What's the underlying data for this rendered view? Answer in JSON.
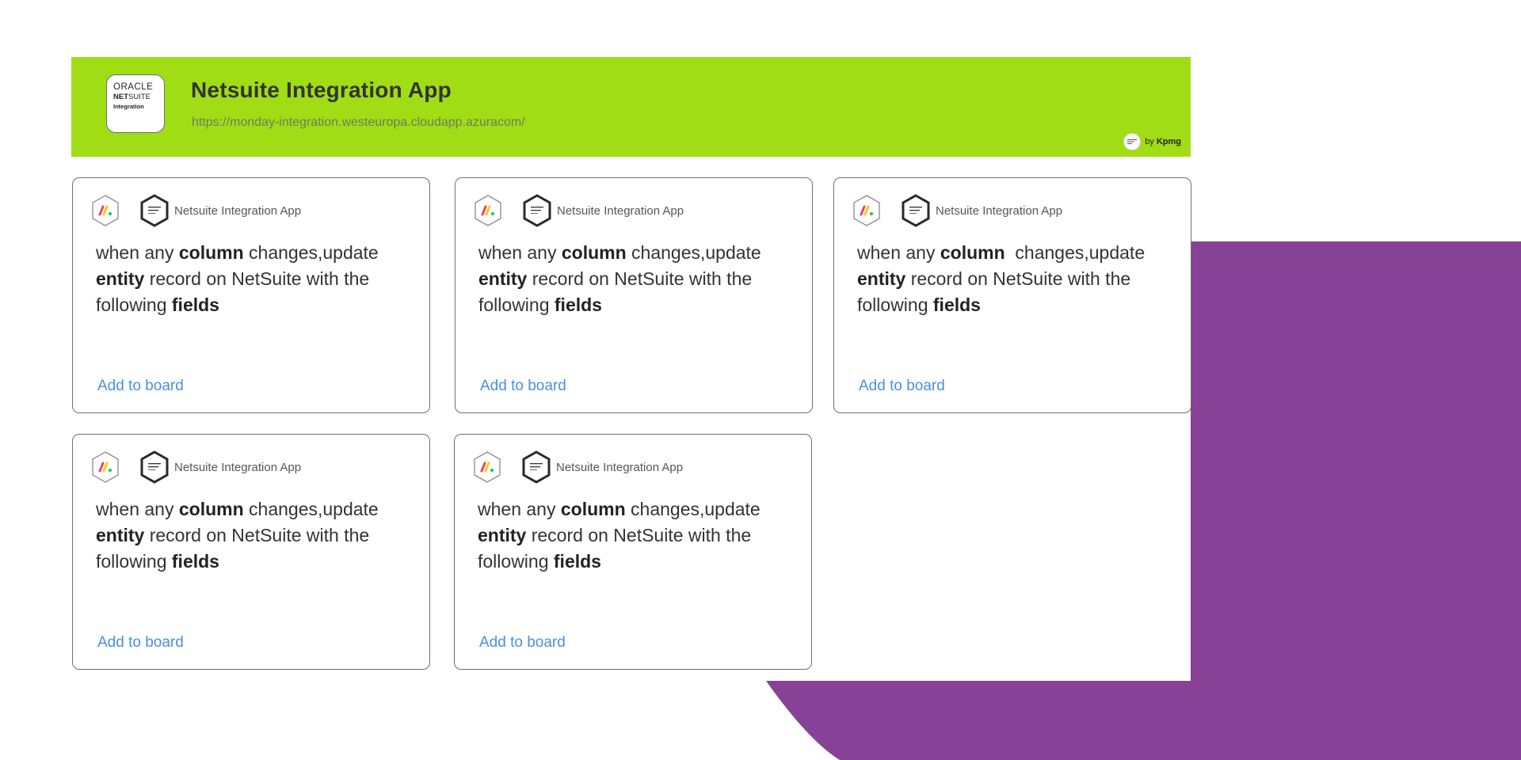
{
  "header": {
    "logo": {
      "line1": "ORACLE",
      "line2_bold": "NET",
      "line2_thin": "SUITE",
      "line3": "Integration"
    },
    "title": "Netsuite Integration App",
    "url": "https://monday-integration.westeuropa.cloudapp.azuracom/",
    "vendor_prefix": "by",
    "vendor_name": "Kpmg"
  },
  "cards": [
    {
      "app_name": "Netsuite Integration App",
      "parts": [
        "when any ",
        "column",
        " changes,update ",
        "entity",
        " record on NetSuite with the following ",
        "fields"
      ],
      "link": "Add to board"
    },
    {
      "app_name": "Netsuite Integration App",
      "parts": [
        "when any ",
        "column",
        " changes,update ",
        "entity",
        " record on NetSuite with the following ",
        "fields"
      ],
      "link": "Add to board"
    },
    {
      "app_name": "Netsuite Integration App",
      "parts": [
        "when any ",
        "column",
        "  changes,update ",
        "entity",
        " record on NetSuite with the following ",
        "fields"
      ],
      "link": "Add to board"
    },
    {
      "app_name": "Netsuite Integration App",
      "parts": [
        "when any ",
        "column",
        " changes,update ",
        "entity",
        " record on NetSuite with the following ",
        "fields"
      ],
      "link": "Add to board"
    },
    {
      "app_name": "Netsuite Integration App",
      "parts": [
        "when any ",
        "column",
        " changes,update ",
        "entity",
        " record on NetSuite with the following ",
        "fields"
      ],
      "link": "Add to board"
    }
  ],
  "colors": {
    "header_green": "#a1dd14",
    "accent_purple": "#874196",
    "link_blue": "#4a90e2"
  },
  "icons": [
    "monday-hex-icon",
    "netsuite-hex-icon"
  ]
}
